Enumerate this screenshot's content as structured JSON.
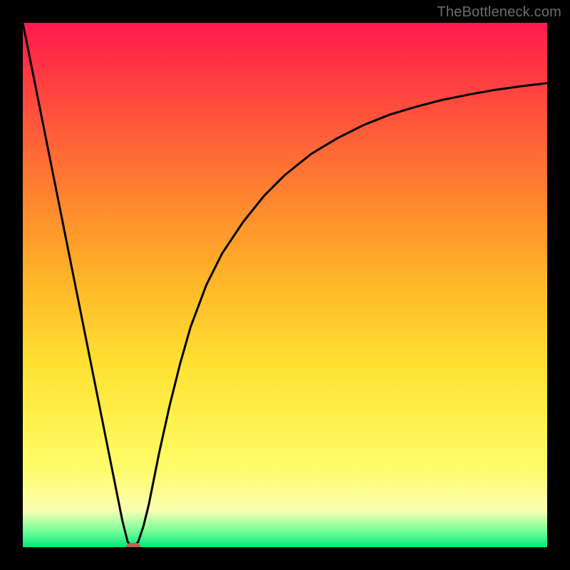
{
  "watermark": "TheBottleneck.com",
  "colors": {
    "frame": "#000000",
    "curve": "#000000",
    "marker": "#c75a55",
    "gradient_top": "#ff1a4d",
    "gradient_bottom": "#00e777"
  },
  "chart_data": {
    "type": "line",
    "title": "",
    "xlabel": "",
    "ylabel": "",
    "xlim": [
      0,
      100
    ],
    "ylim": [
      0,
      100
    ],
    "grid": false,
    "legend": false,
    "series": [
      {
        "name": "bottleneck-curve",
        "x": [
          0,
          2,
          4,
          6,
          8,
          10,
          12,
          14,
          16,
          18,
          19,
          20,
          21,
          22,
          23,
          24,
          25,
          26,
          28,
          30,
          32,
          35,
          38,
          42,
          46,
          50,
          55,
          60,
          65,
          70,
          75,
          80,
          85,
          90,
          95,
          100
        ],
        "y": [
          100,
          90,
          80,
          70,
          60,
          50,
          40,
          30,
          20,
          10,
          5,
          1,
          0,
          1,
          4,
          8,
          13,
          18,
          27,
          35,
          42,
          50,
          56,
          62,
          67,
          71,
          75,
          78,
          80.5,
          82.5,
          84,
          85.3,
          86.3,
          87.2,
          87.9,
          88.5
        ]
      }
    ],
    "annotations": [
      {
        "name": "optimum-marker",
        "x": 21,
        "y": 0,
        "shape": "rounded-rect",
        "color": "#c75a55"
      }
    ]
  }
}
